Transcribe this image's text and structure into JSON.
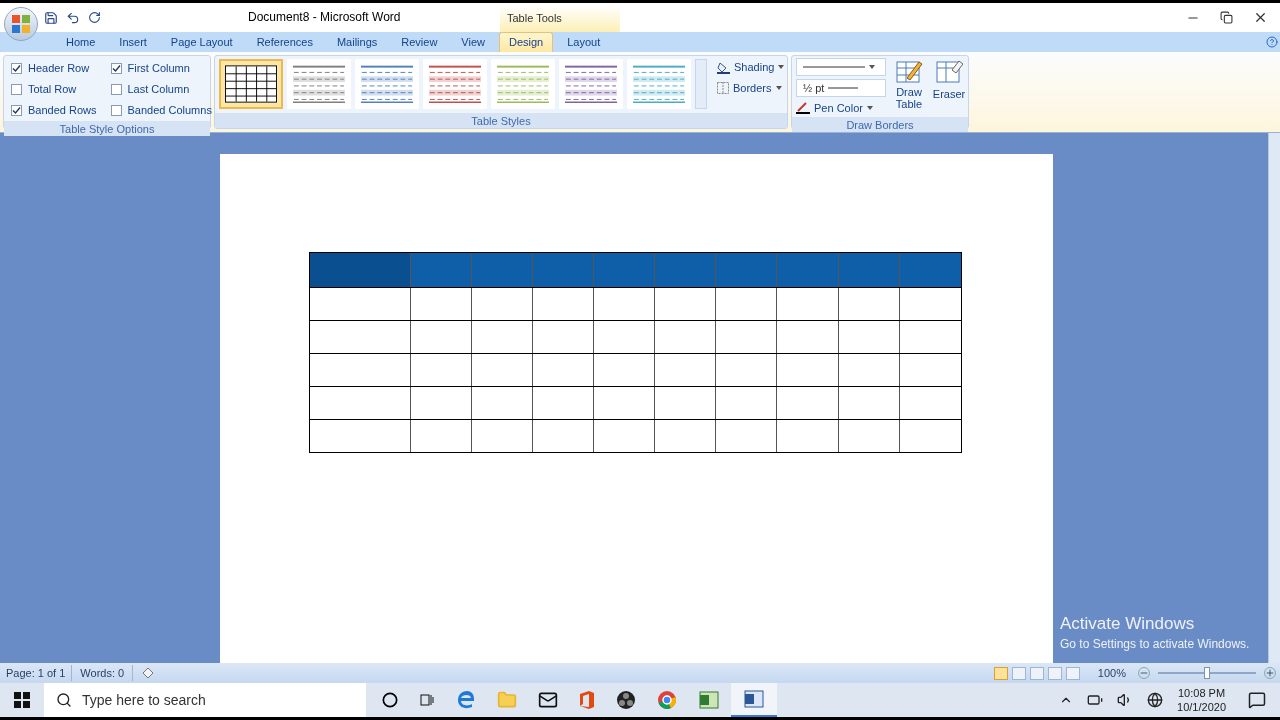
{
  "window": {
    "title": "Document8 - Microsoft Word",
    "context_group": "Table Tools"
  },
  "tabs": [
    {
      "label": "Home",
      "selected": false
    },
    {
      "label": "Insert",
      "selected": false
    },
    {
      "label": "Page Layout",
      "selected": false
    },
    {
      "label": "References",
      "selected": false
    },
    {
      "label": "Mailings",
      "selected": false
    },
    {
      "label": "Review",
      "selected": false
    },
    {
      "label": "View",
      "selected": false
    },
    {
      "label": "Design",
      "selected": true
    },
    {
      "label": "Layout",
      "selected": false
    }
  ],
  "table_style_options": {
    "title": "Table Style Options",
    "options": [
      {
        "label": "Header Row",
        "checked": true
      },
      {
        "label": "Total Row",
        "checked": false
      },
      {
        "label": "Banded Rows",
        "checked": true
      },
      {
        "label": "First Column",
        "checked": true
      },
      {
        "label": "Last Column",
        "checked": false
      },
      {
        "label": "Banded Columns",
        "checked": false
      }
    ]
  },
  "table_styles": {
    "title": "Table Styles",
    "styles": [
      {
        "color": "#000000",
        "selected": true
      },
      {
        "color": "#7f7f7f",
        "selected": false
      },
      {
        "color": "#4f81bd",
        "selected": false
      },
      {
        "color": "#c0504d",
        "selected": false
      },
      {
        "color": "#9bbb59",
        "selected": false
      },
      {
        "color": "#8064a2",
        "selected": false
      },
      {
        "color": "#4bacc6",
        "selected": false
      }
    ],
    "shading": "Shading",
    "borders": "Borders"
  },
  "draw_borders": {
    "title": "Draw Borders",
    "line_weight": "½ pt",
    "pen_color": "Pen Color",
    "draw_table": "Draw Table",
    "eraser": "Eraser"
  },
  "status_bar": {
    "page": "Page: 1 of 1",
    "words": "Words: 0",
    "zoom": "100%",
    "zoom_slider": {
      "level": 0.5
    }
  },
  "activation_notice": {
    "title": "Activate Windows",
    "subtitle": "Go to Settings to activate Windows."
  },
  "taskbar": {
    "search_placeholder": "Type here to search",
    "time": "10:08 PM",
    "date": "10/1/2020"
  }
}
